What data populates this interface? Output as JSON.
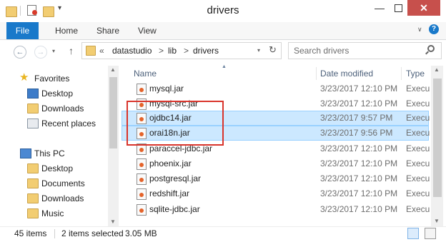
{
  "window": {
    "title": "drivers"
  },
  "ribbon": {
    "file": "File",
    "home": "Home",
    "share": "Share",
    "view": "View"
  },
  "address": {
    "overflow": "«",
    "crumbs": [
      "datastudio",
      "lib",
      "drivers"
    ],
    "separator": ">",
    "search_placeholder": "Search drivers"
  },
  "nav": {
    "favorites": "Favorites",
    "desktop": "Desktop",
    "downloads": "Downloads",
    "recent": "Recent places",
    "thispc": "This PC",
    "pc_desktop": "Desktop",
    "documents": "Documents",
    "pc_downloads": "Downloads",
    "music": "Music"
  },
  "columns": {
    "name": "Name",
    "date": "Date modified",
    "type": "Type"
  },
  "files": [
    {
      "name": "mysql.jar",
      "date": "3/23/2017 12:10 PM",
      "type": "Execu"
    },
    {
      "name": "mysql-src.jar",
      "date": "3/23/2017 12:10 PM",
      "type": "Execu"
    },
    {
      "name": "ojdbc14.jar",
      "date": "3/23/2017 9:57 PM",
      "type": "Execu"
    },
    {
      "name": "orai18n.jar",
      "date": "3/23/2017 9:56 PM",
      "type": "Execu"
    },
    {
      "name": "paraccel-jdbc.jar",
      "date": "3/23/2017 12:10 PM",
      "type": "Execu"
    },
    {
      "name": "phoenix.jar",
      "date": "3/23/2017 12:10 PM",
      "type": "Execu"
    },
    {
      "name": "postgresql.jar",
      "date": "3/23/2017 12:10 PM",
      "type": "Execu"
    },
    {
      "name": "redshift.jar",
      "date": "3/23/2017 12:10 PM",
      "type": "Execu"
    },
    {
      "name": "sqlite-jdbc.jar",
      "date": "3/23/2017 12:10 PM",
      "type": "Execu"
    }
  ],
  "status": {
    "count": "45 items",
    "selected": "2 items selected",
    "size": "3.05 MB"
  },
  "colors": {
    "accent": "#1979ca",
    "selection": "#cce8ff",
    "highlight_box": "#d9342b"
  }
}
